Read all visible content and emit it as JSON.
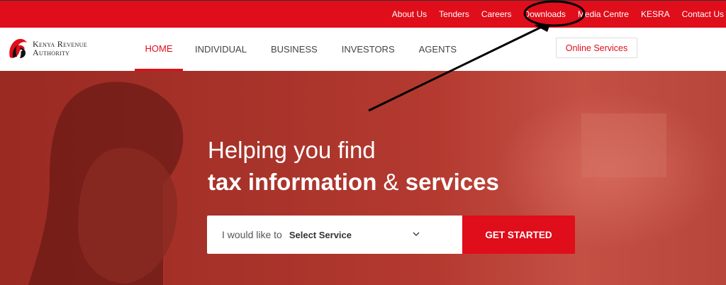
{
  "top_links": [
    "About Us",
    "Tenders",
    "Careers",
    "Downloads",
    "Media Centre",
    "KESRA",
    "Contact Us"
  ],
  "logo": {
    "line1": "Kenya Revenue",
    "line2": "Authority"
  },
  "nav": {
    "items": [
      "HOME",
      "INDIVIDUAL",
      "BUSINESS",
      "INVESTORS",
      "AGENTS"
    ],
    "active": "HOME"
  },
  "online_services": "Online Services",
  "hero": {
    "line1": "Helping you find",
    "line2a": "tax information",
    "line2b": "&",
    "line2c": "services",
    "search_prefix": "I would like to",
    "select_value": "Select Service",
    "cta": "GET STARTED"
  },
  "colors": {
    "brand_red": "#e00d1b"
  },
  "icons": {
    "select": "chevron-down-icon",
    "logo": "lion-head-icon"
  }
}
